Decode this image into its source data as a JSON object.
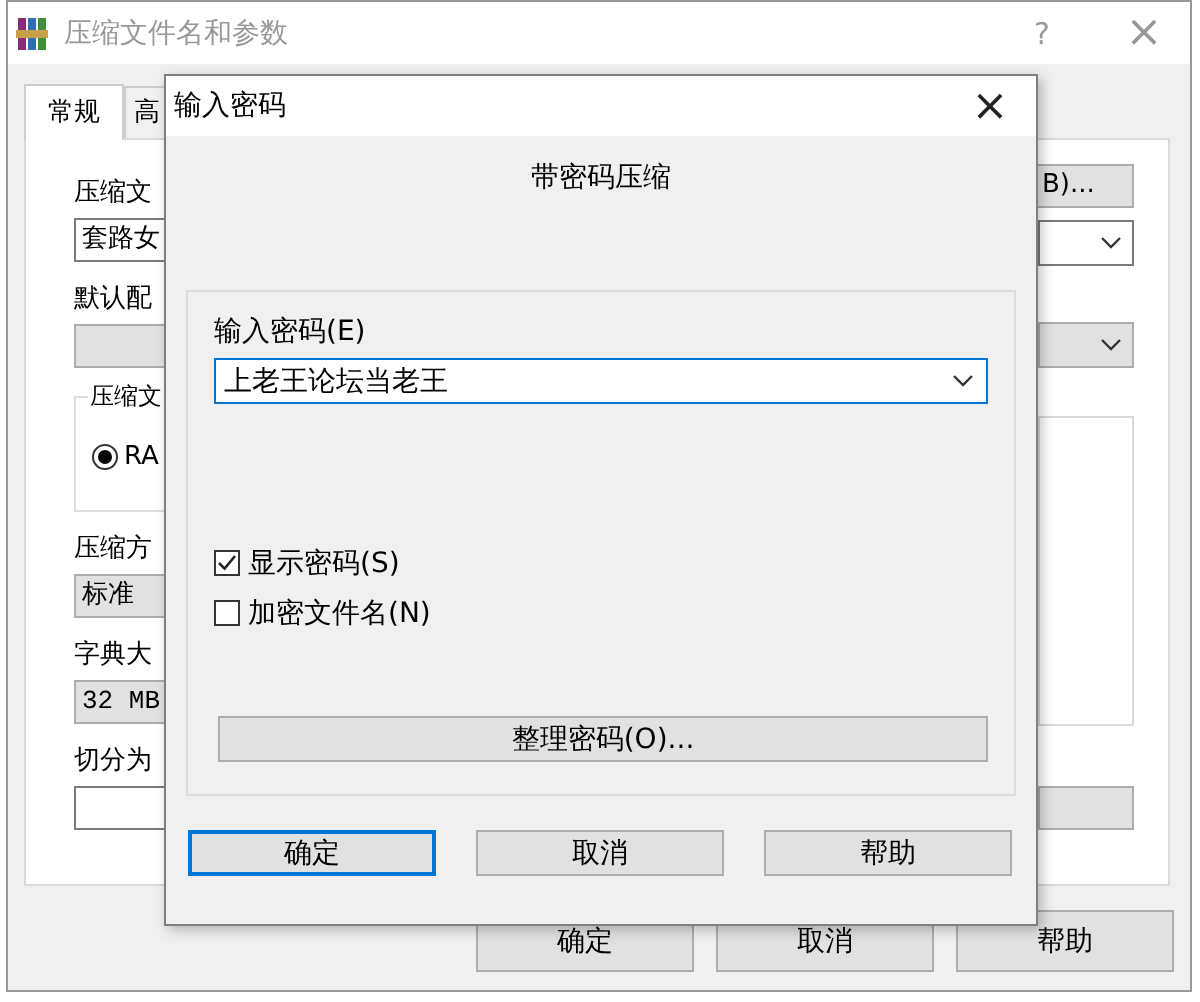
{
  "back_window": {
    "title": "压缩文件名和参数",
    "help_mark": "?",
    "close_mark": "×",
    "tabs": [
      {
        "label": "常规",
        "selected": true
      },
      {
        "label": "高",
        "selected": false
      }
    ],
    "left_items": [
      {
        "kind": "label",
        "text": "压缩文"
      },
      {
        "kind": "field",
        "text": "套路女"
      },
      {
        "kind": "label",
        "text": "默认配"
      },
      {
        "kind": "grey-field"
      },
      {
        "kind": "group",
        "legend": "压缩文",
        "radio": {
          "label": "RA",
          "selected": true
        }
      },
      {
        "kind": "label",
        "text": "压缩方"
      },
      {
        "kind": "grey-field",
        "text": "标准"
      },
      {
        "kind": "label",
        "text": "字典大"
      },
      {
        "kind": "grey-field",
        "text": "32 MB"
      },
      {
        "kind": "label",
        "text": "切分为"
      },
      {
        "kind": "field"
      }
    ],
    "right_items": [
      {
        "kind": "button",
        "text": "B)..."
      },
      {
        "kind": "combo"
      },
      {
        "kind": "grey-combo"
      },
      {
        "kind": "list"
      },
      {
        "kind": "button"
      }
    ],
    "buttons": [
      "确定",
      "取消",
      "帮助"
    ]
  },
  "password_dialog": {
    "title": "输入密码",
    "close_mark": "×",
    "heading": "带密码压缩",
    "password_label": "输入密码(E)",
    "password": {
      "value": "上老王论坛当老王",
      "focused": true
    },
    "options": [
      {
        "label": "显示密码(S)",
        "checked": true
      },
      {
        "label": "加密文件名(N)",
        "checked": false
      }
    ],
    "manage_button": "整理密码(O)...",
    "buttons": [
      {
        "label": "确定",
        "default": true
      },
      {
        "label": "取消",
        "default": false
      },
      {
        "label": "帮助",
        "default": false
      }
    ]
  }
}
